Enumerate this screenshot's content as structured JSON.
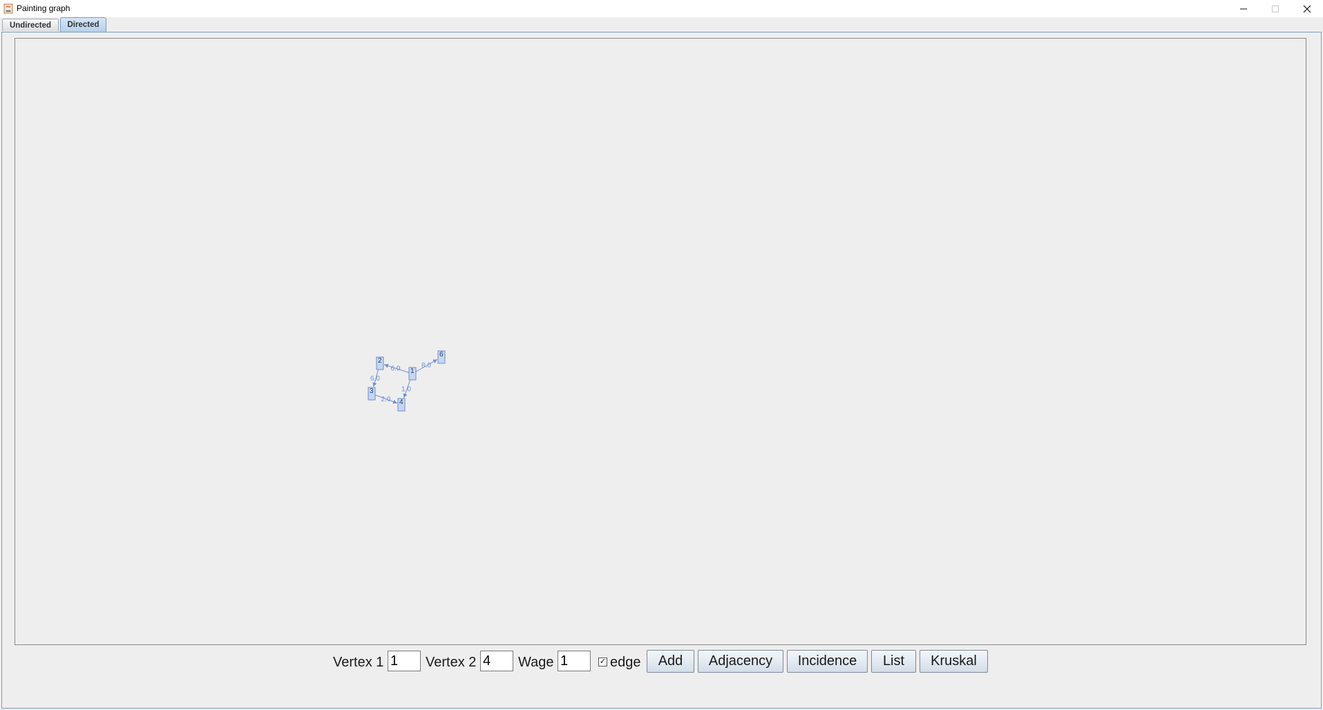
{
  "window": {
    "title": "Painting graph"
  },
  "tabs": [
    {
      "label": "Undirected",
      "selected": false
    },
    {
      "label": "Directed",
      "selected": true
    }
  ],
  "graph": {
    "vertices": [
      {
        "label": "1"
      },
      {
        "label": "2"
      },
      {
        "label": "3"
      },
      {
        "label": "4"
      },
      {
        "label": "6"
      }
    ],
    "edges": [
      {
        "from": "1",
        "to": "2",
        "weight": "6.0"
      },
      {
        "from": "1",
        "to": "6",
        "weight": "8.0"
      },
      {
        "from": "1",
        "to": "4",
        "weight": "1.0"
      },
      {
        "from": "2",
        "to": "3",
        "weight": "6.0"
      },
      {
        "from": "3",
        "to": "4",
        "weight": "2.0"
      }
    ],
    "color": "#6f8fd0",
    "vertex_fill": "#c7d6f0"
  },
  "controls": {
    "vertex1_label": "Vertex 1",
    "vertex1_value": "1",
    "vertex2_label": "Vertex 2",
    "vertex2_value": "4",
    "wage_label": "Wage",
    "wage_value": "1",
    "edge_checkbox_checked": true,
    "edge_label": "edge",
    "add_button": "Add",
    "adjacency_button": "Adjacency",
    "incidence_button": "Incidence",
    "list_button": "List",
    "kruskal_button": "Kruskal"
  }
}
